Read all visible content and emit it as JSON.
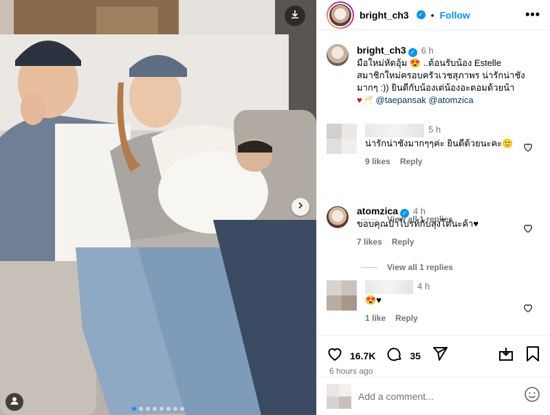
{
  "post": {
    "username": "bright_ch3",
    "follow_label": "Follow",
    "separator": "•",
    "more_label": "•••"
  },
  "caption": {
    "username": "bright_ch3",
    "time": "6 h",
    "line1": "มือใหม่หัดอุ้ม 😍 ..ต้อนรับน้อง Estelle",
    "line2": "สมาชิกใหม่ครอบครัวเวชสุภาพร น่ารักน่าชัง",
    "line3": "มากๆ :)) ยินดีกับน้องเต่น้องอะตอมด้วยน้า",
    "emojis": "♥🥂",
    "mention1": "@taepansak",
    "mention2": "@atomzica"
  },
  "comments": [
    {
      "time": "5 h",
      "text": "น่ารักน่าชังมากๆๆค่ะ ยินดีด้วยนะคะ🙂",
      "likes": "9 likes",
      "reply": "Reply",
      "view_replies": "View all 1 replies"
    },
    {
      "username": "atomzica",
      "time": "4 h",
      "text": "ขอบคุณป๋าไบรท์กับลุงโต๋นะค้า♥",
      "likes": "7 likes",
      "reply": "Reply",
      "view_replies": "View all 1 replies"
    },
    {
      "time": "4 h",
      "text": "😍♥",
      "likes": "1 like",
      "reply": "Reply"
    }
  ],
  "stats": {
    "likes": "16.7K",
    "comments": "35",
    "posted": "6 hours ago"
  },
  "add_comment": {
    "placeholder": "Add a comment..."
  },
  "carousel": {
    "count": 8,
    "active": 0
  },
  "colors": {
    "accent": "#0095f6",
    "heart": "#c8102e"
  },
  "icons": [
    "download-icon",
    "chevron-right-icon",
    "user-tag-icon",
    "heart-icon",
    "comment-icon",
    "share-icon",
    "save-icon",
    "emoji-icon"
  ]
}
